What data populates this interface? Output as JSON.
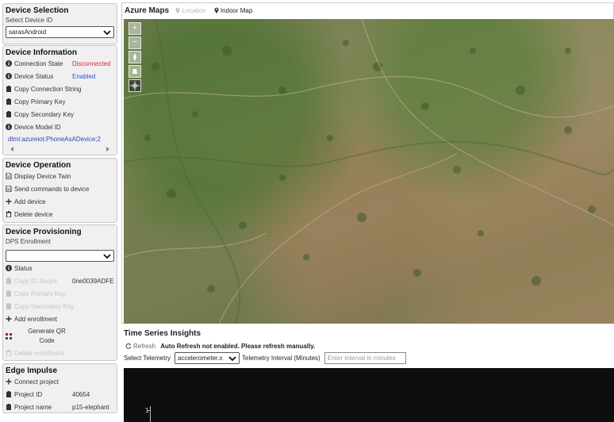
{
  "device_selection": {
    "title": "Device Selection",
    "select_label": "Select Device ID",
    "selected_device": "sarasAndroid"
  },
  "device_information": {
    "title": "Device Information",
    "connection_state_label": "Connection State",
    "connection_state_value": "Disconnected",
    "device_status_label": "Device Status",
    "device_status_value": "Enabled",
    "copy_connection_string": "Copy Connection String",
    "copy_primary_key": "Copy Primary Key",
    "copy_secondary_key": "Copy Secondary Key",
    "device_model_id_label": "Device Model ID",
    "device_model_id_value": "dtmi:azureiot:PhoneAsADevice;2"
  },
  "device_operation": {
    "title": "Device Operation",
    "display_twin": "Display Device Twin",
    "send_commands": "Send commands to device",
    "add_device": "Add device",
    "delete_device": "Delete device"
  },
  "device_provisioning": {
    "title": "Device Provisioning",
    "dps_label": "DPS Enrollment",
    "dps_selected": "",
    "status_label": "Status",
    "copy_id_scope": "Copy ID Scope",
    "id_scope_value": "0ne0039ADFE",
    "copy_primary_key": "Copy Primary Key",
    "copy_secondary_key": "Copy Secondary Key",
    "add_enrollment": "Add enrollment",
    "generate_qr_line1": "Generate QR",
    "generate_qr_line2": "Code",
    "delete_enrollment": "Delete enrollment"
  },
  "edge_impulse": {
    "title": "Edge Impulse",
    "connect_project": "Connect project",
    "project_id_label": "Project ID",
    "project_id_value": "40654",
    "project_name_label": "Project name",
    "project_name_value": "p15-elephant"
  },
  "azure_maps": {
    "title": "Azure Maps",
    "location_label": "Location",
    "indoor_map_label": "Indoor Map",
    "zoom_in": "+",
    "zoom_out": "−"
  },
  "time_series_insights": {
    "title": "Time Series Insights",
    "refresh_label": "Refresh",
    "auto_refresh_message": "Auto Refresh not enabled. Please refresh manually.",
    "select_telemetry_label": "Select Telemetry",
    "selected_telemetry": "accelerometer.x",
    "interval_label": "Telemetry Interval (Minutes)",
    "interval_placeholder": "Enter interval in minutes",
    "chart_y_tick": "1"
  },
  "icons": {
    "info": "info-circle-icon",
    "copy": "clipboard-icon",
    "plus": "plus-icon",
    "trash": "trash-icon",
    "document": "document-icon",
    "pin": "map-pin-icon",
    "refresh": "refresh-icon",
    "qr": "qr-code-icon"
  },
  "colors": {
    "disconnected": "#e0242b",
    "enabled": "#3355cc",
    "link": "#3344bb",
    "chart_bg": "#0d0d0d"
  }
}
